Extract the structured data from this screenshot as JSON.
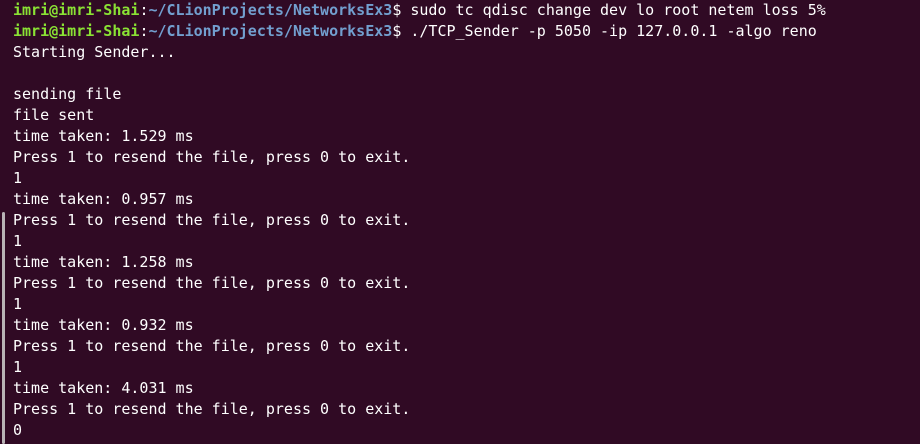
{
  "colors": {
    "background": "#300a24",
    "user_host": "#8ae234",
    "path": "#729fcf",
    "text": "#ffffff"
  },
  "prompt": {
    "user_host": "imri@imri-Shai",
    "colon": ":",
    "path": "~/CLionProjects/NetworksEx3",
    "symbol": "$"
  },
  "commands": [
    " sudo tc qdisc change dev lo root netem loss 5%",
    " ./TCP_Sender -p 5050 -ip 127.0.0.1 -algo reno"
  ],
  "output": [
    "Starting Sender...",
    "",
    "sending file",
    "file sent",
    "time taken: 1.529 ms",
    "Press 1 to resend the file, press 0 to exit.",
    "1",
    "time taken: 0.957 ms",
    "Press 1 to resend the file, press 0 to exit.",
    "1",
    "time taken: 1.258 ms",
    "Press 1 to resend the file, press 0 to exit.",
    "1",
    "time taken: 0.932 ms",
    "Press 1 to resend the file, press 0 to exit.",
    "1",
    "time taken: 4.031 ms",
    "Press 1 to resend the file, press 0 to exit.",
    "0"
  ]
}
